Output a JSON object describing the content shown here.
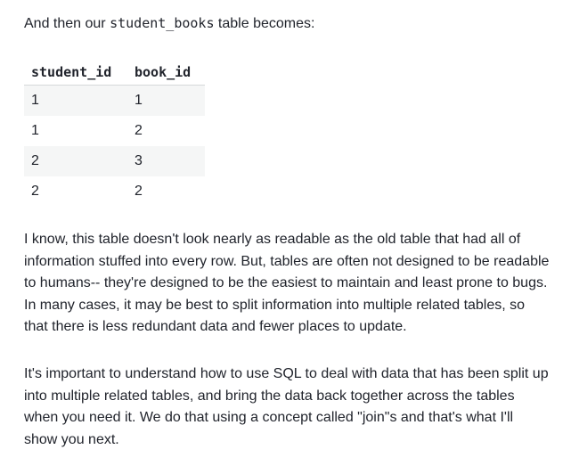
{
  "intro": {
    "before": "And then our ",
    "code": "student_books",
    "after": " table becomes:"
  },
  "table": {
    "headers": [
      "student_id",
      "book_id"
    ],
    "rows": [
      [
        "1",
        "1"
      ],
      [
        "1",
        "2"
      ],
      [
        "2",
        "3"
      ],
      [
        "2",
        "2"
      ]
    ]
  },
  "paragraphs": [
    "I know, this table doesn't look nearly as readable as the old table that had all of information stuffed into every row. But, tables are often not designed to be readable to humans-- they're designed to be the easiest to maintain and least prone to bugs. In many cases, it may be best to split information into multiple related tables, so that there is less redundant data and fewer places to update.",
    "It's important to understand how to use SQL to deal with data that has been split up into multiple related tables, and bring the data back together across the tables when you need it. We do that using a concept called \"join\"s and that's what I'll show you next."
  ]
}
